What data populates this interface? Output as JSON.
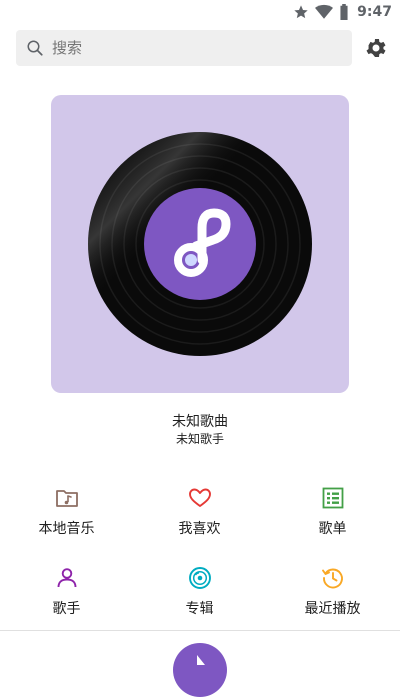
{
  "status_bar": {
    "time": "9:47"
  },
  "search": {
    "placeholder": "搜索"
  },
  "now_playing": {
    "title": "未知歌曲",
    "artist": "未知歌手"
  },
  "menu": [
    {
      "label": "本地音乐",
      "icon": "local-music-folder-icon",
      "color": "#8d6e63"
    },
    {
      "label": "我喜欢",
      "icon": "heart-icon",
      "color": "#e53935"
    },
    {
      "label": "歌单",
      "icon": "playlist-icon",
      "color": "#43a047"
    },
    {
      "label": "歌手",
      "icon": "singer-person-icon",
      "color": "#8e24aa"
    },
    {
      "label": "专辑",
      "icon": "album-disc-icon",
      "color": "#00acc1"
    },
    {
      "label": "最近播放",
      "icon": "recent-history-icon",
      "color": "#f9a825"
    }
  ],
  "colors": {
    "accent": "#7e57c2",
    "cover_bg": "#d2c7ea",
    "search_bg": "#efefef"
  }
}
